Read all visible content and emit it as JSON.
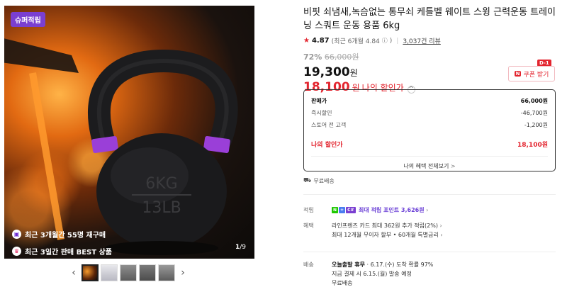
{
  "gallery": {
    "badge": "슈퍼적립",
    "promos": [
      {
        "icon": "repurchase-icon",
        "text": "최근 3개월간 55명 재구매"
      },
      {
        "icon": "best-seller-icon",
        "text": "최근 3일간 판매 BEST 상품"
      }
    ],
    "kettlebell_text_1": "6KG",
    "kettlebell_text_2": "13LB",
    "page_current": "1",
    "page_total": "/9",
    "thumbnail_count": 5
  },
  "product": {
    "title": "비핏 쇠냄새,녹슴없는 통무쇠 케틀벨 웨이트 스윙 근력운동 트레이닝 스쿼트 운동 용품 6kg",
    "rating": "4.87",
    "rating_detail": "(최근 6개월 4.84",
    "rating_detail_end": ")",
    "review_count": "3,037건 리뷰",
    "discount_pct": "72%",
    "original_price": "66,000원",
    "sale_price": "19,300",
    "sale_unit": "원",
    "my_price": "18,100",
    "my_price_unit": "원",
    "my_price_label": "나의 할인가",
    "caret": "^"
  },
  "coupon": {
    "dday": "D-1",
    "icon_text": "N",
    "label": "쿠폰 받기"
  },
  "breakdown": {
    "rows": [
      {
        "label": "판매가",
        "value": "66,000원"
      },
      {
        "label": "즉시할인",
        "value": "-46,700원"
      },
      {
        "label": "스토어 전 고객",
        "value": "-1,200원"
      }
    ],
    "mine_label": "나의 할인가",
    "mine_value": "18,100원",
    "all_benefits": "나의 혜택 전체보기",
    "all_chevron": ">"
  },
  "shipping_free": "무료배송",
  "details": {
    "points_label": "적립",
    "points_text": "최대 적립 포인트 3,626원",
    "points_badge_n": "N",
    "points_badge_plus": "+",
    "points_badge_c": "C#",
    "benefits_label": "혜택",
    "benefit_1": "라인프렌즈 카드 최대 362원 추가 적립(2%)",
    "benefit_2": "최대 12개월 무이자 할부 • 60개월 특별금리",
    "delivery_label": "배송",
    "delivery_strong": "오늘출발 휴무",
    "delivery_eta": " · 6.17.(수) 도착 확률 97%",
    "delivery_line2": "지금 결제 시 6.15.(월) 발송 예정",
    "delivery_line3": "무료배송"
  },
  "colors": {
    "accent_red": "#e3252f",
    "badge_purple": "#7a3fd1",
    "kettlebell_band": "#9a3fd8"
  }
}
